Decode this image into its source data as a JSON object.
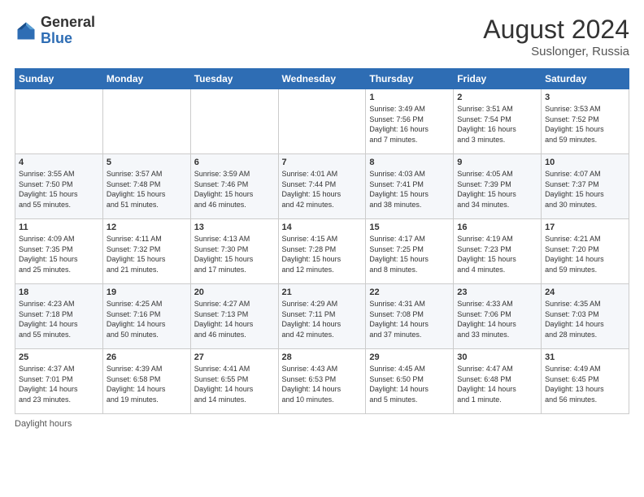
{
  "header": {
    "logo_general": "General",
    "logo_blue": "Blue",
    "month_year": "August 2024",
    "location": "Suslonger, Russia"
  },
  "days_of_week": [
    "Sunday",
    "Monday",
    "Tuesday",
    "Wednesday",
    "Thursday",
    "Friday",
    "Saturday"
  ],
  "weeks": [
    [
      {
        "day": "",
        "info": ""
      },
      {
        "day": "",
        "info": ""
      },
      {
        "day": "",
        "info": ""
      },
      {
        "day": "",
        "info": ""
      },
      {
        "day": "1",
        "info": "Sunrise: 3:49 AM\nSunset: 7:56 PM\nDaylight: 16 hours\nand 7 minutes."
      },
      {
        "day": "2",
        "info": "Sunrise: 3:51 AM\nSunset: 7:54 PM\nDaylight: 16 hours\nand 3 minutes."
      },
      {
        "day": "3",
        "info": "Sunrise: 3:53 AM\nSunset: 7:52 PM\nDaylight: 15 hours\nand 59 minutes."
      }
    ],
    [
      {
        "day": "4",
        "info": "Sunrise: 3:55 AM\nSunset: 7:50 PM\nDaylight: 15 hours\nand 55 minutes."
      },
      {
        "day": "5",
        "info": "Sunrise: 3:57 AM\nSunset: 7:48 PM\nDaylight: 15 hours\nand 51 minutes."
      },
      {
        "day": "6",
        "info": "Sunrise: 3:59 AM\nSunset: 7:46 PM\nDaylight: 15 hours\nand 46 minutes."
      },
      {
        "day": "7",
        "info": "Sunrise: 4:01 AM\nSunset: 7:44 PM\nDaylight: 15 hours\nand 42 minutes."
      },
      {
        "day": "8",
        "info": "Sunrise: 4:03 AM\nSunset: 7:41 PM\nDaylight: 15 hours\nand 38 minutes."
      },
      {
        "day": "9",
        "info": "Sunrise: 4:05 AM\nSunset: 7:39 PM\nDaylight: 15 hours\nand 34 minutes."
      },
      {
        "day": "10",
        "info": "Sunrise: 4:07 AM\nSunset: 7:37 PM\nDaylight: 15 hours\nand 30 minutes."
      }
    ],
    [
      {
        "day": "11",
        "info": "Sunrise: 4:09 AM\nSunset: 7:35 PM\nDaylight: 15 hours\nand 25 minutes."
      },
      {
        "day": "12",
        "info": "Sunrise: 4:11 AM\nSunset: 7:32 PM\nDaylight: 15 hours\nand 21 minutes."
      },
      {
        "day": "13",
        "info": "Sunrise: 4:13 AM\nSunset: 7:30 PM\nDaylight: 15 hours\nand 17 minutes."
      },
      {
        "day": "14",
        "info": "Sunrise: 4:15 AM\nSunset: 7:28 PM\nDaylight: 15 hours\nand 12 minutes."
      },
      {
        "day": "15",
        "info": "Sunrise: 4:17 AM\nSunset: 7:25 PM\nDaylight: 15 hours\nand 8 minutes."
      },
      {
        "day": "16",
        "info": "Sunrise: 4:19 AM\nSunset: 7:23 PM\nDaylight: 15 hours\nand 4 minutes."
      },
      {
        "day": "17",
        "info": "Sunrise: 4:21 AM\nSunset: 7:20 PM\nDaylight: 14 hours\nand 59 minutes."
      }
    ],
    [
      {
        "day": "18",
        "info": "Sunrise: 4:23 AM\nSunset: 7:18 PM\nDaylight: 14 hours\nand 55 minutes."
      },
      {
        "day": "19",
        "info": "Sunrise: 4:25 AM\nSunset: 7:16 PM\nDaylight: 14 hours\nand 50 minutes."
      },
      {
        "day": "20",
        "info": "Sunrise: 4:27 AM\nSunset: 7:13 PM\nDaylight: 14 hours\nand 46 minutes."
      },
      {
        "day": "21",
        "info": "Sunrise: 4:29 AM\nSunset: 7:11 PM\nDaylight: 14 hours\nand 42 minutes."
      },
      {
        "day": "22",
        "info": "Sunrise: 4:31 AM\nSunset: 7:08 PM\nDaylight: 14 hours\nand 37 minutes."
      },
      {
        "day": "23",
        "info": "Sunrise: 4:33 AM\nSunset: 7:06 PM\nDaylight: 14 hours\nand 33 minutes."
      },
      {
        "day": "24",
        "info": "Sunrise: 4:35 AM\nSunset: 7:03 PM\nDaylight: 14 hours\nand 28 minutes."
      }
    ],
    [
      {
        "day": "25",
        "info": "Sunrise: 4:37 AM\nSunset: 7:01 PM\nDaylight: 14 hours\nand 23 minutes."
      },
      {
        "day": "26",
        "info": "Sunrise: 4:39 AM\nSunset: 6:58 PM\nDaylight: 14 hours\nand 19 minutes."
      },
      {
        "day": "27",
        "info": "Sunrise: 4:41 AM\nSunset: 6:55 PM\nDaylight: 14 hours\nand 14 minutes."
      },
      {
        "day": "28",
        "info": "Sunrise: 4:43 AM\nSunset: 6:53 PM\nDaylight: 14 hours\nand 10 minutes."
      },
      {
        "day": "29",
        "info": "Sunrise: 4:45 AM\nSunset: 6:50 PM\nDaylight: 14 hours\nand 5 minutes."
      },
      {
        "day": "30",
        "info": "Sunrise: 4:47 AM\nSunset: 6:48 PM\nDaylight: 14 hours\nand 1 minute."
      },
      {
        "day": "31",
        "info": "Sunrise: 4:49 AM\nSunset: 6:45 PM\nDaylight: 13 hours\nand 56 minutes."
      }
    ]
  ],
  "footer": {
    "note": "Daylight hours"
  }
}
